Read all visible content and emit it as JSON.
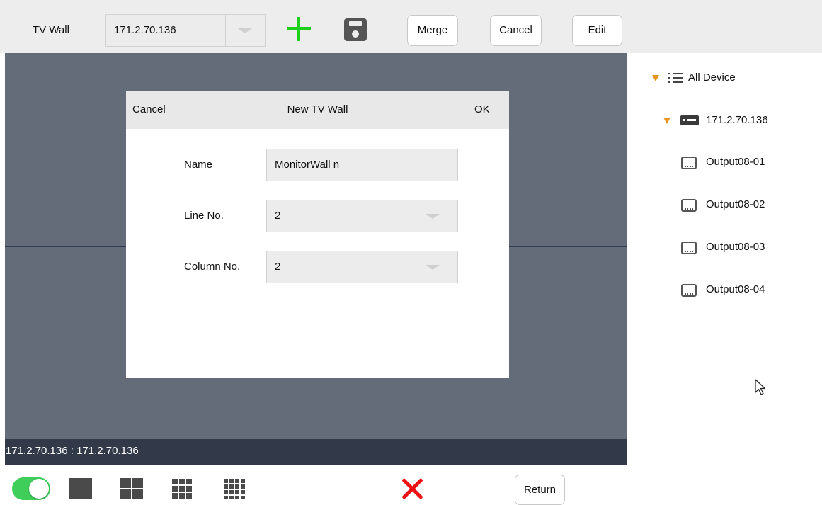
{
  "toolbar": {
    "label": "TV Wall",
    "device": "171.2.70.136",
    "add_icon": "plus-icon",
    "save_icon": "save-icon",
    "merge": "Merge",
    "cancel": "Cancel",
    "edit": "Edit"
  },
  "status": {
    "text": "171.2.70.136 : 171.2.70.136"
  },
  "dialog": {
    "cancel": "Cancel",
    "title": "New TV Wall",
    "ok": "OK",
    "name_label": "Name",
    "name_value": "MonitorWall n",
    "line_label": "Line No.",
    "line_value": "2",
    "column_label": "Column No.",
    "column_value": "2"
  },
  "tree": {
    "root": "All Device",
    "device": "171.2.70.136",
    "outputs": [
      "Output08-01",
      "Output08-02",
      "Output08-03",
      "Output08-04"
    ]
  },
  "bottom": {
    "toggle_on": true,
    "layouts": [
      "layout-1x1-icon",
      "layout-2x2-icon",
      "layout-3x3-icon",
      "layout-4x4-icon"
    ],
    "delete_icon": "close-icon",
    "return": "Return"
  },
  "colors": {
    "wall_bg": "#646c7a",
    "status_bg": "#323a4a",
    "accent_green": "#3fce5a",
    "add_green": "#1ecf1e",
    "delete_red": "#ee1111",
    "tree_arrow": "#e8951f"
  }
}
